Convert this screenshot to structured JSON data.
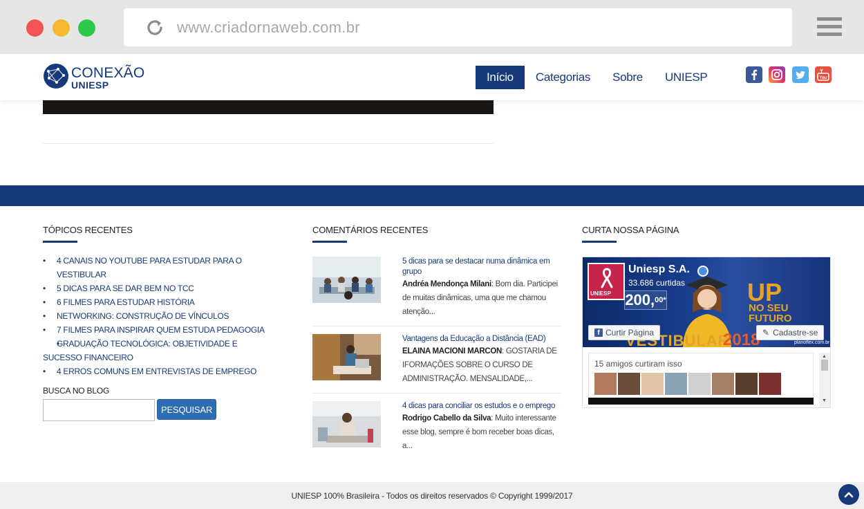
{
  "browser": {
    "url": "www.criadornaweb.com.br"
  },
  "header": {
    "logo_line1": "CONEXÃO",
    "logo_line2": "UNIESP",
    "nav": [
      {
        "label": "Início",
        "active": true
      },
      {
        "label": "Categorias",
        "active": false
      },
      {
        "label": "Sobre",
        "active": false
      },
      {
        "label": "UNIESP",
        "active": false
      }
    ],
    "social_icons": [
      "facebook-icon",
      "instagram-icon",
      "twitter-icon",
      "youtube-icon"
    ]
  },
  "topics": {
    "title": "TÓPICOS RECENTES",
    "items": [
      "4 CANAIS NO YOUTUBE PARA ESTUDAR PARA O VESTIBULAR",
      "5 DICAS PARA SE DAR BEM NO TCC",
      "6 FILMES PARA ESTUDAR HISTÓRIA",
      "NETWORKING: CONSTRUÇÃO DE VÍNCULOS",
      "7 FILMES PARA INSPIRAR QUEM ESTUDA PEDAGOGIA",
      "GRADUAÇÃO TECNOLÓGICA: OBJETIVIDADE E SUCESSO FINANCEIRO",
      "4 ERROS COMUNS EM ENTREVISTAS DE EMPREGO"
    ]
  },
  "search": {
    "label": "BUSCA NO BLOG",
    "button": "PESQUISAR",
    "value": ""
  },
  "comments": {
    "title": "COMENTÁRIOS RECENTES",
    "items": [
      {
        "post_title": "5 dicas para se destacar numa dinâmica em grupo",
        "author": "Andréa Mendonça Milani",
        "text": "Bom dia. Participei de muitas dinâmicas, uma que me chamou atenção..."
      },
      {
        "post_title": "Vantagens da Educação a Distância (EAD)",
        "author": "ELAINA MACIONI MARCON",
        "text": "GOSTARIA DE IFORMAÇÕES SOBRE O CURSO DE ADMINISTRAÇÃO. MENSALIDADE,..."
      },
      {
        "post_title": "4 dicas para conciliar os estudos e o emprego",
        "author": "Rodrigo Cabello da Silva",
        "text": "Muito interessante esse blog, sempre é bom receber boas dicas, a..."
      }
    ]
  },
  "facebook": {
    "title": "CURTA NOSSA PÁGINA",
    "page_name": "Uniesp S.A.",
    "likes": "33.686 curtidas",
    "logo_text": "UNIESP",
    "price": "200,",
    "price_cents": "00*",
    "banner_up": "UP",
    "banner_noseu": "NO SEU",
    "banner_futuro": "FUTURO",
    "banner_vestibular": "VESTIBULAR",
    "banner_year": "2018",
    "banner_site": "planoflex.com.br",
    "like_button": "Curtir Página",
    "signup_button": "Cadastre-se",
    "friends_text": "15 amigos curtiram isso"
  },
  "footer": {
    "copyright": "UNIESP 100% Brasileira - Todos os direitos reservados © Copyright 1999/2017"
  }
}
